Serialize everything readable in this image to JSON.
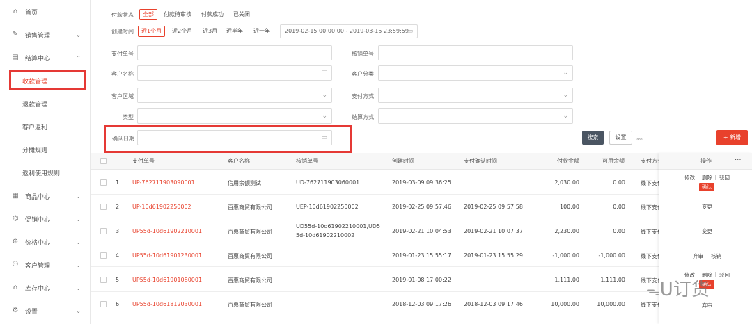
{
  "sidebar": {
    "items": [
      {
        "label": "首页",
        "icon": "home-icon"
      },
      {
        "label": "销售管理",
        "icon": "sales-icon"
      },
      {
        "label": "结算中心",
        "icon": "settlement-icon"
      },
      {
        "label": "商品中心",
        "icon": "grid-icon"
      },
      {
        "label": "促销中心",
        "icon": "tag-icon"
      },
      {
        "label": "价格中心",
        "icon": "price-icon"
      },
      {
        "label": "客户管理",
        "icon": "people-icon"
      },
      {
        "label": "库存中心",
        "icon": "warehouse-icon"
      },
      {
        "label": "设置",
        "icon": "gear-icon"
      }
    ],
    "sub_items": [
      "收款管理",
      "退款管理",
      "客户返利",
      "分摊规则",
      "返利使用规则"
    ]
  },
  "filters": {
    "status_label": "付款状态",
    "status_tags": [
      "全部",
      "付款待审核",
      "付款成功",
      "已关闭"
    ],
    "created_label": "创建时间",
    "created_tags": [
      "近1个月",
      "近2个月",
      "近3月",
      "近半年",
      "近一年"
    ],
    "date_range": "2019-02-15 00:00:00 - 2019-03-15 23:59:59",
    "pay_no_label": "支付单号",
    "verify_no_label": "核销单号",
    "customer_name_label": "客户名称",
    "customer_category_label": "客户分类",
    "customer_region_label": "客户区域",
    "pay_method_label": "支付方式",
    "type_label": "类型",
    "settle_method_label": "结算方式",
    "confirm_date_label": "确认日期",
    "search_btn": "搜索",
    "settings_btn": "设置",
    "new_btn": "+ 新增"
  },
  "table": {
    "headers": [
      "支付单号",
      "客户名称",
      "核销单号",
      "创建时间",
      "支付确认时间",
      "付款金额",
      "可用余额",
      "支付方式",
      "操作"
    ],
    "rows": [
      {
        "idx": "1",
        "pay_no": "UP-762711903090001",
        "customer": "信用余额测试",
        "verify": "UD-762711903060001",
        "verify2": "",
        "created": "2019-03-09 09:36:25",
        "confirmed": "",
        "amount": "2,030.00",
        "balance": "0.00",
        "method": "线下支付"
      },
      {
        "idx": "2",
        "pay_no": "UP-10d61902250002",
        "customer": "百惠商贸有限公司",
        "verify": "UEP-10d61902250002",
        "verify2": "",
        "created": "2019-02-25 09:57:46",
        "confirmed": "2019-02-25 09:57:58",
        "amount": "100.00",
        "balance": "0.00",
        "method": "线下支付"
      },
      {
        "idx": "3",
        "pay_no": "UP55d-10d61902210001",
        "customer": "百惠商贸有限公司",
        "verify": "UD55d-10d61902210001,UD5",
        "verify2": "5d-10d61902210002",
        "created": "2019-02-21 10:04:53",
        "confirmed": "2019-02-21 10:07:37",
        "amount": "2,230.00",
        "balance": "0.00",
        "method": "线下支付"
      },
      {
        "idx": "4",
        "pay_no": "UP55d-10d61901230001",
        "customer": "百惠商贸有限公司",
        "verify": "",
        "verify2": "",
        "created": "2019-01-23 15:55:17",
        "confirmed": "2019-01-23 15:55:29",
        "amount": "-1,000.00",
        "balance": "-1,000.00",
        "method": "线下支付"
      },
      {
        "idx": "5",
        "pay_no": "UP55d-10d61901080001",
        "customer": "百惠商贸有限公司",
        "verify": "",
        "verify2": "",
        "created": "2019-01-08 17:00:22",
        "confirmed": "",
        "amount": "1,111.00",
        "balance": "1,111.00",
        "method": "线下支付"
      },
      {
        "idx": "6",
        "pay_no": "UP55d-10d61812030001",
        "customer": "百惠商贸有限公司",
        "verify": "",
        "verify2": "",
        "created": "2018-12-03 09:17:26",
        "confirmed": "2018-12-03 09:17:46",
        "amount": "10,000.00",
        "balance": "10,000.00",
        "method": "线下支付"
      }
    ],
    "ops": {
      "edit": "修改",
      "delete": "删除",
      "reject": "驳回",
      "confirm": "确认",
      "change": "变更",
      "review": "弃审",
      "verify": "核销",
      "more": "···"
    }
  },
  "watermark": "U订货"
}
